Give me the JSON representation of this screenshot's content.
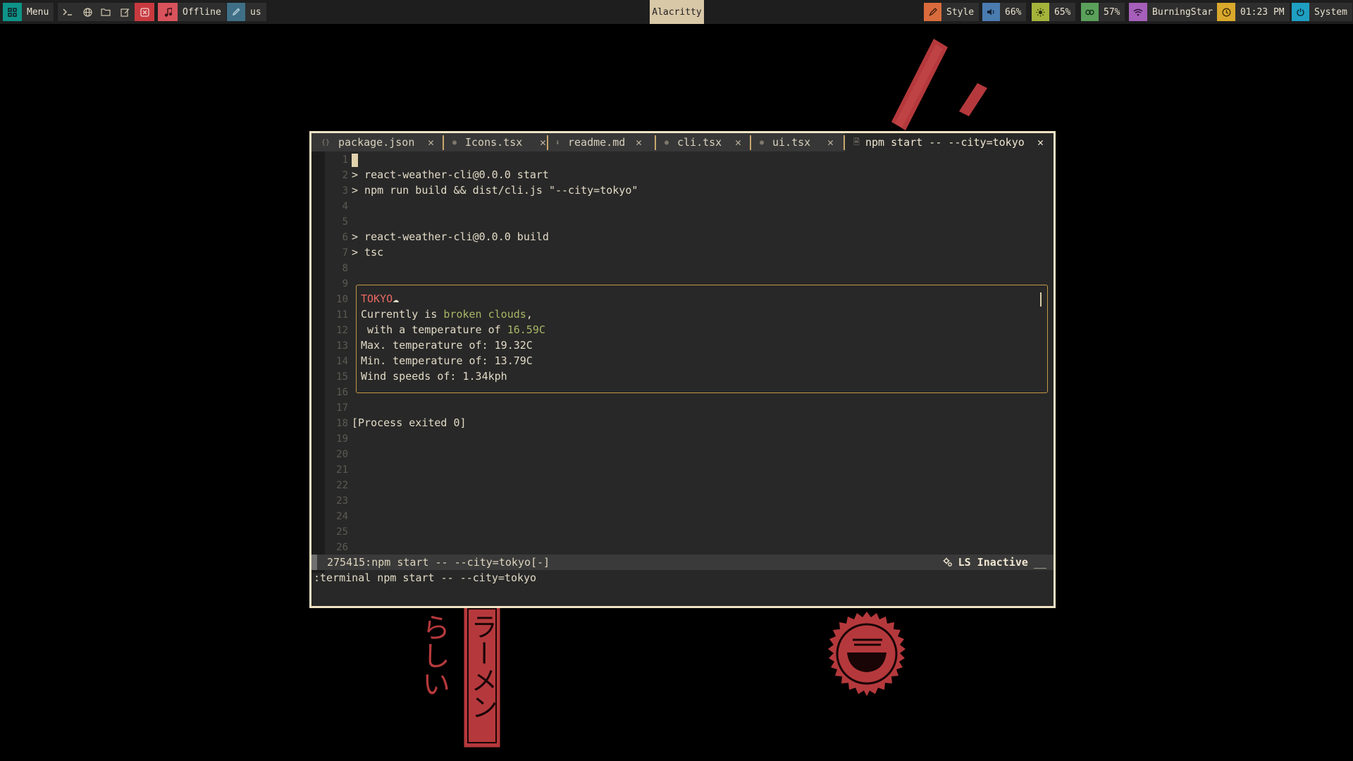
{
  "topbar": {
    "menu_label": "Menu",
    "music_label": "Offline",
    "keyboard_label": "us",
    "window_title": "Alacritty",
    "style_label": "Style",
    "volume": "66%",
    "brightness": "65%",
    "battery": "57%",
    "wifi": "BurningStar",
    "clock": "01:23 PM",
    "system_label": "System"
  },
  "wallpaper": {
    "kana_left": "らしい",
    "kana_right": "ラーメン"
  },
  "tabs": [
    {
      "icon": "braces-icon",
      "label": "package.json",
      "close": "✕"
    },
    {
      "icon": "dot-icon",
      "label": "Icons.tsx",
      "close": "✕"
    },
    {
      "icon": "download-icon",
      "label": "readme.md",
      "close": "✕"
    },
    {
      "icon": "dot-icon",
      "label": "cli.tsx",
      "close": "✕"
    },
    {
      "icon": "dot-icon",
      "label": "ui.tsx",
      "close": "✕"
    },
    {
      "icon": "file-icon",
      "label": "npm start -- --city=tokyo",
      "close": "✕"
    }
  ],
  "lines": [
    "1",
    "2",
    "3",
    "4",
    "5",
    "6",
    "7",
    "8",
    "9",
    "10",
    "11",
    "12",
    "13",
    "14",
    "15",
    "16",
    "17",
    "18",
    "19",
    "20",
    "21",
    "22",
    "23",
    "24",
    "25",
    "26"
  ],
  "output": {
    "start_cmd": "> react-weather-cli@0.0.0 start",
    "run_cmd": "> npm run build && dist/cli.js \"--city=tokyo\"",
    "build_cmd": "> react-weather-cli@0.0.0 build",
    "tsc_cmd": "> tsc",
    "process_exit": "[Process exited 0]"
  },
  "weather": {
    "city": "TOKYO",
    "icon": "☁",
    "currently_prefix": "Currently is ",
    "condition": "broken clouds",
    "currently_suffix": ",",
    "temp_prefix": " with a temperature of ",
    "temp": "16.59C",
    "max_line": "Max. temperature of: 19.32C",
    "min_line": "Min. temperature of: 13.79C",
    "wind_line": "Wind speeds of: 1.34kph"
  },
  "status": {
    "buffer": "275415:npm start -- --city=tokyo[-]",
    "ls_state": "LS Inactive",
    "tail": "__"
  },
  "command_line": ":terminal npm start -- --city=tokyo",
  "colors": {
    "accent_gold": "#c49a47",
    "window_border": "#efe3c4",
    "wallpaper_red": "#b5393c"
  }
}
